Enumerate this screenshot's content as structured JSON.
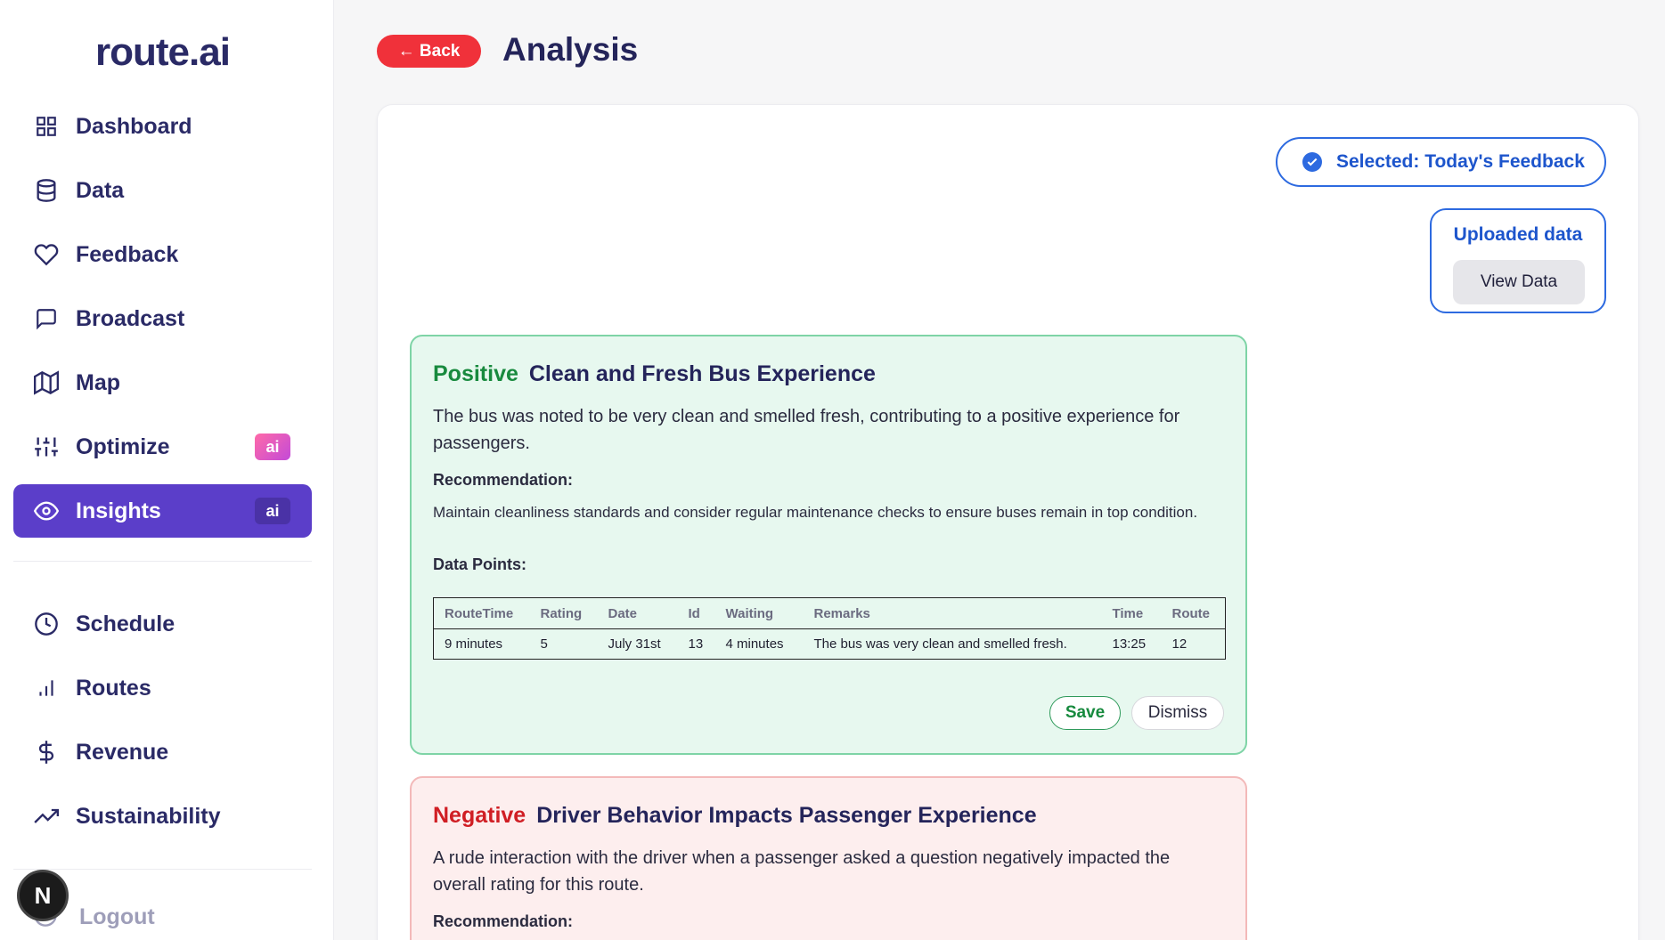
{
  "app": {
    "logo": "route.ai"
  },
  "sidebar": {
    "items": [
      {
        "label": "Dashboard",
        "icon": "grid-icon"
      },
      {
        "label": "Data",
        "icon": "database-icon"
      },
      {
        "label": "Feedback",
        "icon": "heart-icon"
      },
      {
        "label": "Broadcast",
        "icon": "chat-icon"
      },
      {
        "label": "Map",
        "icon": "map-icon"
      },
      {
        "label": "Optimize",
        "icon": "sliders-icon",
        "badge": "ai"
      },
      {
        "label": "Insights",
        "icon": "eye-icon",
        "badge": "ai",
        "active": true
      }
    ],
    "items2": [
      {
        "label": "Schedule",
        "icon": "clock-icon"
      },
      {
        "label": "Routes",
        "icon": "bar-chart-icon"
      },
      {
        "label": "Revenue",
        "icon": "dollar-icon"
      },
      {
        "label": "Sustainability",
        "icon": "trending-up-icon"
      }
    ],
    "logout": "Logout",
    "avatar_letter": "N"
  },
  "header": {
    "back_label": "← Back",
    "title": "Analysis"
  },
  "selection": {
    "label": "Selected: Today's Feedback"
  },
  "uploaded": {
    "title": "Uploaded data",
    "view_label": "View Data"
  },
  "insights": [
    {
      "sentiment": "Positive",
      "title": "Clean and Fresh Bus Experience",
      "description": "The bus was noted to be very clean and smelled fresh, contributing to a positive experience for passengers.",
      "recommendation_label": "Recommendation:",
      "recommendation": "Maintain cleanliness standards and consider regular maintenance checks to ensure buses remain in top condition.",
      "data_points_label": "Data Points:",
      "columns": [
        "RouteTime",
        "Rating",
        "Date",
        "Id",
        "Waiting",
        "Remarks",
        "Time",
        "Route"
      ],
      "rows": [
        [
          "9 minutes",
          "5",
          "July 31st",
          "13",
          "4 minutes",
          "The bus was very clean and smelled fresh.",
          "13:25",
          "12"
        ]
      ],
      "save_label": "Save",
      "dismiss_label": "Dismiss"
    },
    {
      "sentiment": "Negative",
      "title": "Driver Behavior Impacts Passenger Experience",
      "description": "A rude interaction with the driver when a passenger asked a question negatively impacted the overall rating for this route.",
      "recommendation_label": "Recommendation:"
    }
  ],
  "colors": {
    "accent": "#5b3ec9",
    "back": "#f0313a",
    "positive": "#188a3e",
    "negative": "#d01e24",
    "link": "#1d55cc"
  }
}
